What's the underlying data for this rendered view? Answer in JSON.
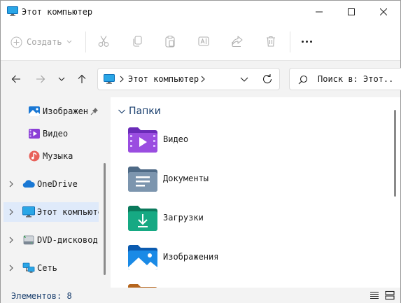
{
  "window": {
    "title": "Этот компьютер"
  },
  "toolbar": {
    "create_label": "Создать"
  },
  "address": {
    "location": "Этот компьютер"
  },
  "search": {
    "placeholder": "Поиск в: Этот.."
  },
  "sidebar": {
    "items": [
      {
        "label": "Изображен",
        "icon": "pictures-icon",
        "pinned": true
      },
      {
        "label": "Видео",
        "icon": "videos-icon"
      },
      {
        "label": "Музыка",
        "icon": "music-icon"
      },
      {
        "label": "OneDrive",
        "icon": "onedrive-icon",
        "expandable": true
      },
      {
        "label": "Этот компьютер",
        "icon": "this-pc-icon",
        "expandable": true,
        "selected": true
      },
      {
        "label": "DVD-дисковод",
        "icon": "dvd-drive-icon",
        "expandable": true
      },
      {
        "label": "Сеть",
        "icon": "network-icon",
        "expandable": true
      }
    ]
  },
  "main": {
    "group_title": "Папки",
    "folders": [
      {
        "label": "Видео",
        "icon": "video-folder-icon"
      },
      {
        "label": "Документы",
        "icon": "documents-folder-icon"
      },
      {
        "label": "Загрузки",
        "icon": "downloads-folder-icon"
      },
      {
        "label": "Изображения",
        "icon": "pictures-folder-icon"
      }
    ]
  },
  "status": {
    "items_count": "Элементов: 8"
  },
  "colors": {
    "accent": "#0067c0",
    "selected_bg": "#dfeafa",
    "group_title": "#1a3f6e"
  }
}
